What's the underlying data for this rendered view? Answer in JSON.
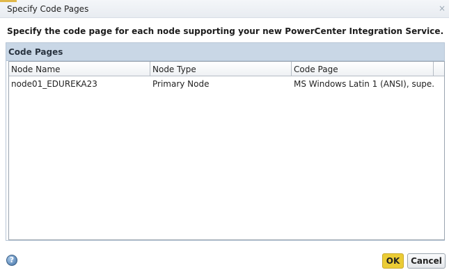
{
  "dialog": {
    "title": "Specify Code Pages",
    "close_glyph": "×",
    "instruction": "Specify the code page for each node supporting your new PowerCenter Integration Service."
  },
  "panel": {
    "title": "Code Pages",
    "columns": [
      "Node Name",
      "Node Type",
      "Code Page"
    ],
    "rows": [
      {
        "node_name": "node01_EDUREKA23",
        "node_type": "Primary Node",
        "code_page": "MS Windows Latin 1 (ANSI), supe..."
      }
    ]
  },
  "footer": {
    "help_glyph": "?",
    "ok_label": "OK",
    "cancel_label": "Cancel"
  },
  "colors": {
    "ok_button": "#ebcc35",
    "panel_header": "#c9d7e6"
  }
}
